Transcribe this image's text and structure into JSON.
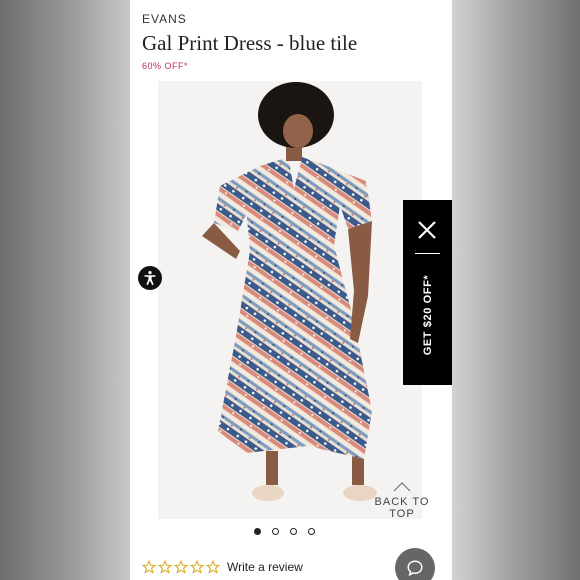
{
  "product": {
    "brand": "EVANS",
    "title": "Gal Print Dress - blue tile",
    "discount": "60% OFF*"
  },
  "gallery": {
    "image_label": "Woman in patterned maxi dress",
    "total_images": 4,
    "active_index": 0
  },
  "back_to_top": "BACK TO TOP",
  "reviews": {
    "stars_filled": 0,
    "stars_total": 5,
    "write_review": "Write a review"
  },
  "promo": {
    "label": "GET $20 OFF*"
  },
  "icons": {
    "accessibility": "accessibility-icon",
    "close": "close-icon",
    "chat": "chat-icon",
    "arrow_up": "chevron-up-icon",
    "star": "star-outline-icon"
  },
  "colors": {
    "discount": "#b8325b",
    "promo_bg": "#000000",
    "star_outline": "#d9a520"
  }
}
